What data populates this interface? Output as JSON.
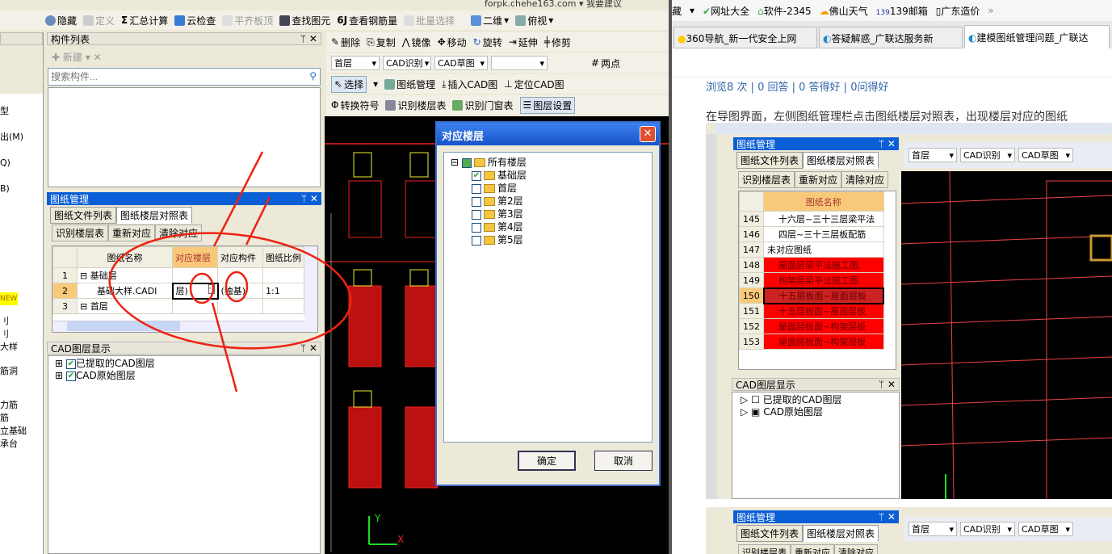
{
  "app": {
    "top_right": [
      "forpk.chehe163.com",
      "我要建议"
    ],
    "toolbar1": {
      "hide": "隐藏",
      "define": "定义",
      "sum": "汇总计算",
      "cloud_check": "云检查",
      "flush_top": "平齐板顶",
      "find": "查找图元",
      "view_rebar": "查看钢筋量",
      "batch_select": "批量选择",
      "view2d": "二维",
      "view_top": "俯视"
    },
    "toolbar2": {
      "delete": "删除",
      "copy": "复制",
      "mirror": "镜像",
      "move": "移动",
      "rotate": "旋转",
      "extend": "延伸",
      "trim": "修剪"
    },
    "toolbar3": {
      "floor": "首层",
      "cad_recog": "CAD识别",
      "cad_sketch": "CAD草图",
      "two_point": "两点"
    },
    "toolbar4": {
      "select": "选择",
      "drawing_mgmt": "图纸管理",
      "insert_cad": "插入CAD图",
      "locate_cad": "定位CAD图"
    },
    "toolbar5": {
      "convert_symbol": "转换符号",
      "recog_floor_table": "识别楼层表",
      "recog_door_table": "识别门窗表",
      "layer_settings": "图层设置"
    },
    "left_sidebar": [
      "型",
      "出(M)",
      "Q)",
      "B)",
      "NEW",
      "刂",
      "刂",
      "大样",
      "筋洞",
      "力筋",
      "筋",
      "立基础",
      "承台"
    ],
    "component_list": {
      "title": "构件列表",
      "new": "新建",
      "search_placeholder": "搜索构件..."
    },
    "drawing_mgmt": {
      "title": "图纸管理",
      "tabs": [
        "图纸文件列表",
        "图纸楼层对照表"
      ],
      "buttons": [
        "识别楼层表",
        "重新对应",
        "清除对应"
      ],
      "columns": [
        "图纸名称",
        "对应楼层",
        "对应构件",
        "图纸比例"
      ],
      "rows": [
        {
          "n": "1",
          "name": "基础层",
          "floor": "",
          "comp": "",
          "scale": ""
        },
        {
          "n": "2",
          "name": "基础大样.CADI",
          "floor": "层)",
          "comp": "(独基)",
          "scale": "1:1"
        },
        {
          "n": "3",
          "name": "首层",
          "floor": "",
          "comp": "",
          "scale": ""
        }
      ]
    },
    "cad_layers": {
      "title": "CAD图层显示",
      "items": [
        "已提取的CAD图层",
        "CAD原始图层"
      ]
    },
    "dialog": {
      "title": "对应楼层",
      "root": "所有楼层",
      "floors": [
        {
          "name": "基础层",
          "checked": true
        },
        {
          "name": "首层",
          "checked": false
        },
        {
          "name": "第2层",
          "checked": false
        },
        {
          "name": "第3层",
          "checked": false
        },
        {
          "name": "第4层",
          "checked": false
        },
        {
          "name": "第5层",
          "checked": false
        }
      ],
      "ok": "确定",
      "cancel": "取消"
    }
  },
  "browser": {
    "bookmarks": [
      "藏",
      "网址大全",
      "软件-2345",
      "佛山天气",
      "139邮箱",
      "广东造价"
    ],
    "tabs": [
      "360导航_新一代安全上网",
      "答疑解惑_广联达服务新",
      "建模图纸管理问题_广联达"
    ],
    "stats": [
      "浏览8 次",
      "0 回答",
      "0 答得好",
      "0问得好"
    ],
    "paragraph": "在导图界面，左侧图纸管理栏点击图纸楼层对照表，出现楼层对应的图纸",
    "shot1": {
      "title": "图纸管理",
      "tabs": [
        "图纸文件列表",
        "图纸楼层对照表"
      ],
      "buttons": [
        "识别楼层表",
        "重新对应",
        "清除对应"
      ],
      "column": "图纸名称",
      "rows": [
        {
          "n": "145",
          "name": "十六层~三十三层梁平法",
          "red": false
        },
        {
          "n": "146",
          "name": "四层~三十三层板配筋",
          "red": false
        },
        {
          "n": "147",
          "name": "未对应图纸",
          "red": false
        },
        {
          "n": "148",
          "name": "屋面层梁平法施工图.",
          "red": true
        },
        {
          "n": "149",
          "name": "构架层梁平法施工图.",
          "red": true
        },
        {
          "n": "150",
          "name": "十五层板面~屋面层板",
          "red": true
        },
        {
          "n": "151",
          "name": "十五层板面~屋面层板",
          "red": true
        },
        {
          "n": "152",
          "name": "屋面层板面~构架层板",
          "red": true
        },
        {
          "n": "153",
          "name": "屋面层板面~构架层板",
          "red": true
        }
      ],
      "toolbar": [
        "首层",
        "CAD识别",
        "CAD草图"
      ],
      "layers_title": "CAD图层显示",
      "layers": [
        "已提取的CAD图层",
        "CAD原始图层"
      ]
    },
    "shot2": {
      "title": "图纸管理",
      "tabs": [
        "图纸文件列表",
        "图纸楼层对照表"
      ],
      "toolbar": [
        "首层",
        "CAD识别",
        "CAD草图"
      ],
      "buttons": [
        "识别楼层表",
        "重新对应",
        "清除对应"
      ]
    }
  }
}
